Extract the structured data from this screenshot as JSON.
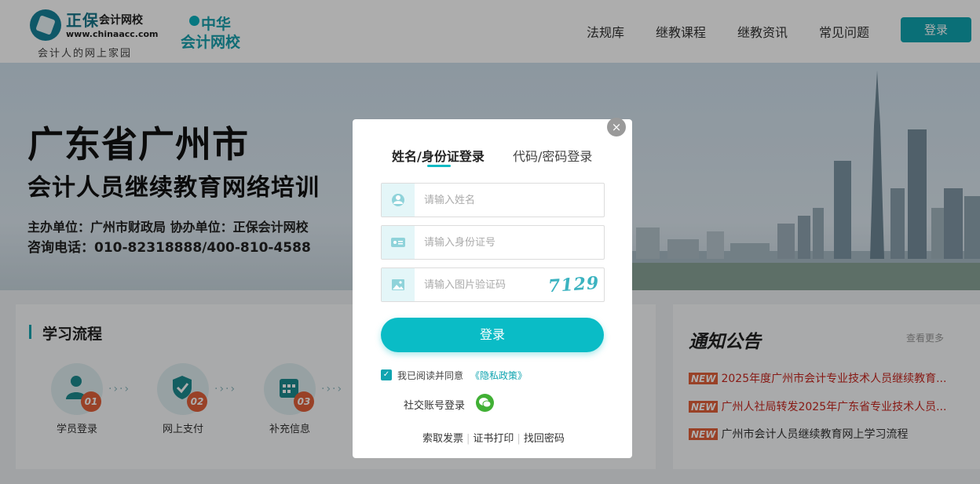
{
  "header": {
    "logo_brand": "正保",
    "logo_brand_suffix": "会计网校",
    "logo_url": "www.chinaacc.com",
    "logo_tagline": "会计人的网上家园",
    "partner_line1": "中华",
    "partner_line2": "会计网校",
    "nav": [
      {
        "label": "法规库"
      },
      {
        "label": "继教课程"
      },
      {
        "label": "继教资讯"
      },
      {
        "label": "常见问题"
      }
    ],
    "login_label": "登录"
  },
  "banner": {
    "title": "广东省广州市",
    "subtitle": "会计人员继续教育网络培训",
    "organizer": "主办单位：广州市财政局   协办单位：正保会计网校",
    "hotline": "咨询电话：010-82318888/400-810-4588"
  },
  "flow": {
    "title": "学习流程",
    "steps": [
      {
        "num": "01",
        "label": "学员登录"
      },
      {
        "num": "02",
        "label": "网上支付"
      },
      {
        "num": "03",
        "label": "补充信息"
      }
    ]
  },
  "notices": {
    "title": "通知公告",
    "more": "查看更多",
    "tag": "NEW",
    "items": [
      {
        "text": "2025年度广州市会计专业技术人员继续教育...",
        "color": "#c7271f"
      },
      {
        "text": "广州人社局转发2025年广东省专业技术人员...",
        "color": "#c7271f"
      },
      {
        "text": "广州市会计人员继续教育网上学习流程",
        "color": "#333333"
      }
    ]
  },
  "modal": {
    "close": "×",
    "tab_active": "姓名/身份证登录",
    "tab_other": "代码/密码登录",
    "name_placeholder": "请输入姓名",
    "id_placeholder": "请输入身份证号",
    "captcha_placeholder": "请输入图片验证码",
    "captcha_code": "7129",
    "login_button": "登录",
    "agree_check": "✓",
    "agree_text": "我已阅读并同意",
    "privacy_link": "《隐私政策》",
    "social_login": "社交账号登录",
    "footer_links": [
      "索取发票",
      "证书打印",
      "找回密码"
    ]
  },
  "colors": {
    "accent": "#0abcc6",
    "brand": "#0fa4b0",
    "new_tag": "#e2603a",
    "wechat": "#41b035"
  }
}
